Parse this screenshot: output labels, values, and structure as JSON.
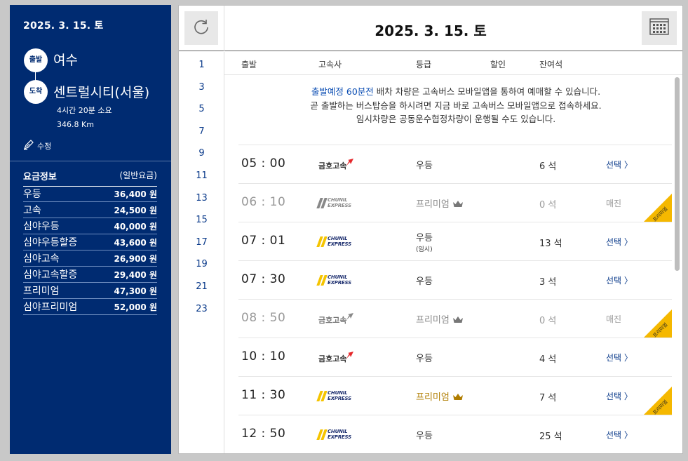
{
  "sidebar": {
    "date": "2025. 3. 15. 토",
    "departure_badge": "출발",
    "departure_city": "여수",
    "arrival_badge": "도착",
    "arrival_city": "센트럴시티(서울)",
    "duration": "4시간 20분 소요",
    "distance": "346.8 Km",
    "edit_label": "수정",
    "fare_title": "요금정보",
    "fare_subtitle": "(일반요금)",
    "fares": [
      {
        "grade": "우등",
        "amount": "36,400 원"
      },
      {
        "grade": "고속",
        "amount": "24,500 원"
      },
      {
        "grade": "심야우등",
        "amount": "40,000 원"
      },
      {
        "grade": "심야우등할증",
        "amount": "43,600 원"
      },
      {
        "grade": "심야고속",
        "amount": "26,900 원"
      },
      {
        "grade": "심야고속할증",
        "amount": "29,400 원"
      },
      {
        "grade": "프리미엄",
        "amount": "47,300 원"
      },
      {
        "grade": "심야프리미엄",
        "amount": "52,000 원"
      }
    ]
  },
  "header": {
    "title": "2025. 3. 15. 토",
    "refresh_icon": "refresh-icon",
    "calendar_icon": "calendar-icon"
  },
  "hours": [
    "1",
    "3",
    "5",
    "7",
    "9",
    "11",
    "13",
    "15",
    "17",
    "19",
    "21",
    "23"
  ],
  "columns": {
    "departure": "출발",
    "company": "고속사",
    "grade": "등급",
    "discount": "할인",
    "seats": "잔여석"
  },
  "notice": {
    "line1_highlight": "출발예정 60분전",
    "line1_rest": " 배차 차량은 고속버스 모바일앱을 통하여 예매할 수 있습니다.",
    "line2": "곧 출발하는 버스탑승을 하시려면 지금 바로 고속버스 모바일앱으로 접속하세요.",
    "line3": "임시차량은 공동운수협정차량이 운행될 수도 있습니다."
  },
  "logos": {
    "kumho": "금호고속",
    "chunil_line1": "CHUNIL",
    "chunil_line2": "EXPRESS"
  },
  "ribbon_label": "프리미엄",
  "schedules": [
    {
      "time": "05 : 00",
      "company": "kumho",
      "grade": "우등",
      "sub": "",
      "seats": "6 석",
      "action": "선택 〉",
      "sold": false,
      "premium": false
    },
    {
      "time": "06 : 10",
      "company": "chunil",
      "grade": "프리미엄",
      "sub": "",
      "seats": "0 석",
      "action": "매진",
      "sold": true,
      "premium": true
    },
    {
      "time": "07 : 01",
      "company": "chunil",
      "grade": "우등",
      "sub": "(임시)",
      "seats": "13 석",
      "action": "선택 〉",
      "sold": false,
      "premium": false
    },
    {
      "time": "07 : 30",
      "company": "chunil",
      "grade": "우등",
      "sub": "",
      "seats": "3 석",
      "action": "선택 〉",
      "sold": false,
      "premium": false
    },
    {
      "time": "08 : 50",
      "company": "kumho",
      "grade": "프리미엄",
      "sub": "",
      "seats": "0 석",
      "action": "매진",
      "sold": true,
      "premium": true
    },
    {
      "time": "10 : 10",
      "company": "kumho",
      "grade": "우등",
      "sub": "",
      "seats": "4 석",
      "action": "선택 〉",
      "sold": false,
      "premium": false
    },
    {
      "time": "11 : 30",
      "company": "chunil",
      "grade": "프리미엄",
      "sub": "",
      "seats": "7 석",
      "action": "선택 〉",
      "sold": false,
      "premium": true
    },
    {
      "time": "12 : 50",
      "company": "chunil",
      "grade": "우등",
      "sub": "",
      "seats": "25 석",
      "action": "선택 〉",
      "sold": false,
      "premium": false
    }
  ]
}
